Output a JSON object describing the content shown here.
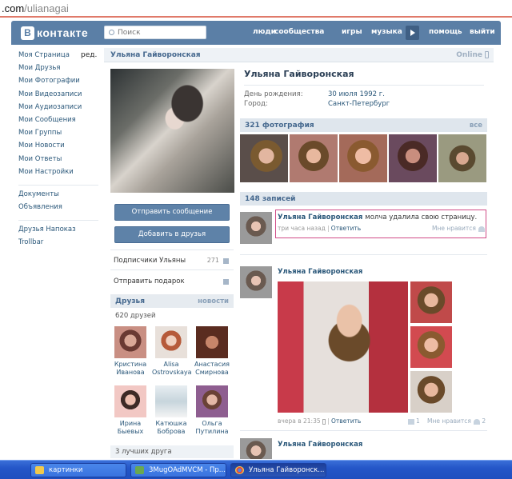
{
  "browser": {
    "url_domain": ".com",
    "url_path": "/ulianagai"
  },
  "header": {
    "logo_text": "контакте",
    "logo_letter": "B",
    "search_placeholder": "Поиск",
    "nav": [
      "люди",
      "сообщества",
      "игры",
      "музыка",
      "помощь",
      "выйти"
    ]
  },
  "leftmenu": {
    "items": [
      "Моя Страница",
      "Мои Друзья",
      "Мои Фотографии",
      "Мои Видеозаписи",
      "Мои Аудиозаписи",
      "Мои Сообщения",
      "Мои Группы",
      "Мои Новости",
      "Мои Ответы",
      "Мои Настройки"
    ],
    "edit_label": "ред.",
    "extra1": [
      "Документы",
      "Объявления"
    ],
    "extra2": [
      "Друзья Напоказ",
      "Trollbar"
    ]
  },
  "profile": {
    "name": "Ульяна Гайворонская",
    "online": "Online",
    "send_message": "Отправить сообщение",
    "add_friend": "Добавить в друзья",
    "subscribers_label": "Подписчики Ульяны",
    "subscribers_count": "271",
    "gift_label": "Отправить подарок",
    "birthday_label": "День рождения:",
    "birthday_value": "30 июля 1992 г.",
    "city_label": "Город:",
    "city_value": "Санкт-Петербург"
  },
  "friends": {
    "title": "Друзья",
    "news": "новости",
    "count": "620 друзей",
    "list": [
      {
        "first": "Кристина",
        "last": "Иванова"
      },
      {
        "first": "Alisa",
        "last": "Ostrovskaya"
      },
      {
        "first": "Анастасия",
        "last": "Смирнова"
      },
      {
        "first": "Ирина",
        "last": "Быевых"
      },
      {
        "first": "Катюшка",
        "last": "Боброва"
      },
      {
        "first": "Ольга",
        "last": "Путилина"
      }
    ],
    "best": "3 лучших друга"
  },
  "photos": {
    "title": "321 фотография",
    "all": "все"
  },
  "wall": {
    "title": "148 записей",
    "post1": {
      "author": "Ульяна Гайворонская",
      "text": "молча удалила свою страницу.",
      "time": "три часа назад",
      "reply": "Ответить",
      "like": "Мне нравится"
    },
    "post2": {
      "author": "Ульяна Гайворонская",
      "time": "вчера в 21:35",
      "reply": "Ответить",
      "shares": "1",
      "like": "Мне нравится",
      "likes": "2"
    },
    "post3": {
      "author": "Ульяна Гайворонская"
    }
  },
  "taskbar": {
    "items": [
      "картинки",
      "3MugOAdMVCM - Пр...",
      "Ульяна Гайворонск..."
    ]
  }
}
